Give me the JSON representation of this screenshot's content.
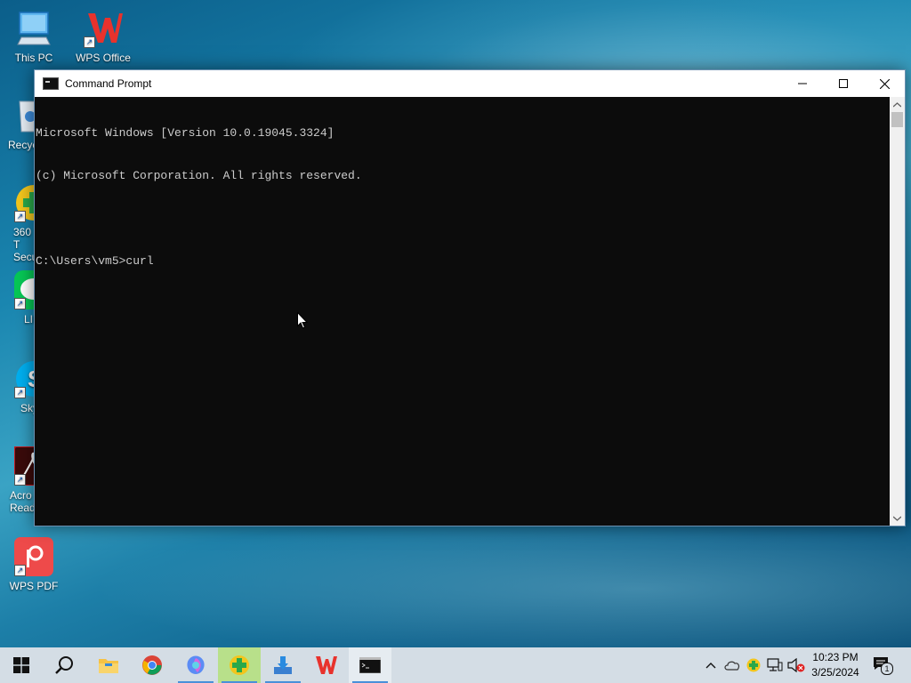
{
  "desktop": {
    "icons": [
      {
        "label": "This PC"
      },
      {
        "label": "WPS Office"
      },
      {
        "label": "Recyc"
      },
      {
        "label": "360 T Secu"
      },
      {
        "label": "LII"
      },
      {
        "label": "Sky"
      },
      {
        "label": "Acro Reade"
      },
      {
        "label": "WPS PDF"
      }
    ]
  },
  "window": {
    "title": "Command Prompt",
    "lines": [
      "Microsoft Windows [Version 10.0.19045.3324]",
      "(c) Microsoft Corporation. All rights reserved.",
      "",
      "C:\\Users\\vm5>curl"
    ]
  },
  "taskbar": {
    "clock_time": "10:23 PM",
    "clock_date": "3/25/2024",
    "notification_count": "1"
  },
  "colors": {
    "console_bg": "#0c0c0c",
    "console_text": "#cccccc",
    "taskbar_bg": "#d4dde5"
  }
}
